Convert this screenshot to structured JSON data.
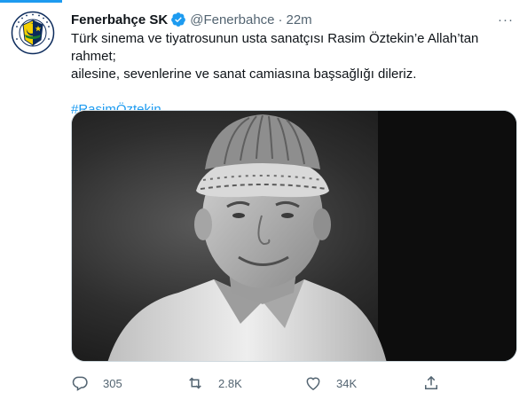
{
  "tweet": {
    "author_name": "Fenerbahçe SK",
    "handle": "@Fenerbahce",
    "separator": "·",
    "time": "22m",
    "more": "···",
    "text_line1": "Türk sinema ve tiyatrosunun usta sanatçısı Rasim Öztekin’e Allah’tan rahmet;",
    "text_line2": "ailesine, sevenlerine ve sanat camiasına başsağlığı dileriz.",
    "hashtag": "#RasimÖztekin",
    "avatar_text": "FENERBAHÇE SPOR KULÜBÜ",
    "avatar_year": "1907"
  },
  "actions": {
    "replies": "305",
    "retweets": "2.8K",
    "likes": "34K"
  },
  "colors": {
    "accent": "#1d9bf0",
    "secondary_text": "#536471",
    "primary_text": "#0f1419",
    "fb_navy": "#0b2a5b",
    "fb_yellow": "#f5d000"
  },
  "icons": [
    "verified-badge-icon",
    "more-icon",
    "reply-icon",
    "retweet-icon",
    "like-icon",
    "share-icon"
  ]
}
